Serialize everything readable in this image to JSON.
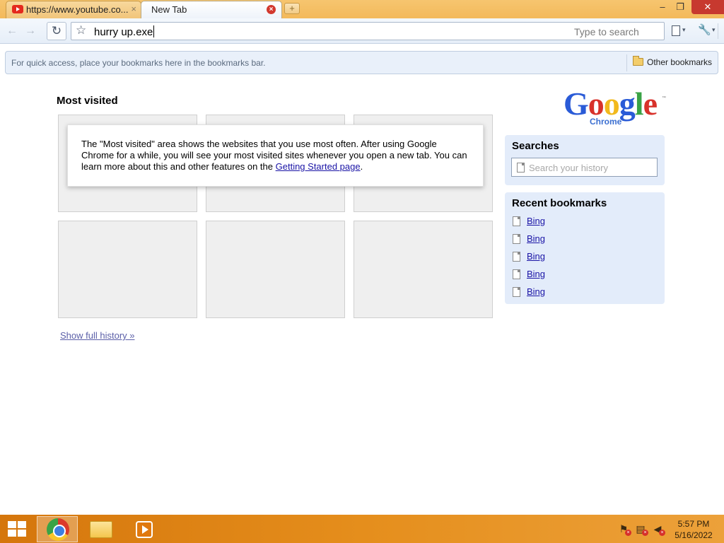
{
  "tabs": [
    {
      "title": "https://www.youtube.co...",
      "close": "×"
    },
    {
      "title": "New Tab",
      "close": "×"
    }
  ],
  "new_tab_symbol": "+",
  "window_controls": {
    "minimize": "–",
    "maximize": "❐",
    "close": "✕"
  },
  "toolbar": {
    "back_icon": "←",
    "forward_icon": "→",
    "reload_icon": "↻",
    "star_icon": "☆",
    "omnibox_value": "hurry up.exe",
    "omnibox_hint": "Type to search",
    "wrench_icon": "🔧",
    "caret": "▾"
  },
  "bookmarks_bar": {
    "hint": "For quick access, place your bookmarks here in the bookmarks bar.",
    "other_bookmarks": "Other bookmarks"
  },
  "most_visited": {
    "title": "Most visited",
    "info_before_link": "The \"Most visited\" area shows the websites that you use most often. After using Google Chrome for a while, you will see your most visited sites whenever you open a new tab. You can learn more about this and other features on the ",
    "info_link": "Getting Started page",
    "info_after_link": ".",
    "show_history": "Show full history »"
  },
  "logo": {
    "letters": [
      {
        "ch": "G",
        "color": "#2a5bd7"
      },
      {
        "ch": "o",
        "color": "#d8322b"
      },
      {
        "ch": "o",
        "color": "#f2b91d"
      },
      {
        "ch": "g",
        "color": "#2a5bd7"
      },
      {
        "ch": "l",
        "color": "#3aa346"
      },
      {
        "ch": "e",
        "color": "#d8322b"
      }
    ],
    "sub": "Chrome",
    "tm": "™"
  },
  "searches": {
    "title": "Searches",
    "placeholder": "Search your history"
  },
  "recent_bookmarks": {
    "title": "Recent bookmarks",
    "items": [
      "Bing",
      "Bing",
      "Bing",
      "Bing",
      "Bing"
    ]
  },
  "taskbar": {
    "tray": {
      "flag_icon": "⚑",
      "network_icon": "▤",
      "volume_icon": "◀",
      "x": "×"
    },
    "time": "5:57 PM",
    "date": "5/16/2022"
  },
  "colors": {
    "titlebar": "#f3b95a",
    "taskbar": "#e58e1c",
    "link": "#1a14a6",
    "panel": "#e3ecfa"
  }
}
